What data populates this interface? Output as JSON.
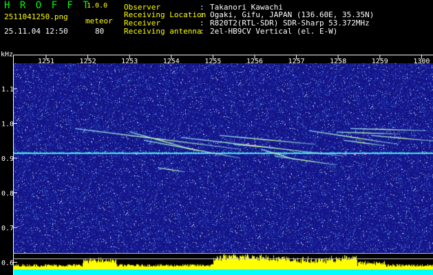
{
  "header": {
    "app_title": "H R O F F T",
    "app_version": "1.0.0",
    "filename": "2511041250.png",
    "meteor_label": "meteor",
    "timestamp": "25.11.04 12:50",
    "meteor_count": "80"
  },
  "info": [
    {
      "label": "Observer",
      "sep": ":",
      "value": "Takanori Kawachi"
    },
    {
      "label": "Receiving Location",
      "sep": ":",
      "value": "Ogaki, Gifu, JAPAN (136.60E, 35.35N)"
    },
    {
      "label": "Receiver",
      "sep": ":",
      "value": "R820T2(RTL-SDR) SDR-Sharp 53.372MHz"
    },
    {
      "label": "Receiving antenna",
      "sep": ":",
      "value": "2el-HB9CV Vertical (el. E-W)"
    }
  ],
  "axis": {
    "y_unit": "kHz",
    "x_ticks": [
      "1251",
      "1252",
      "1253",
      "1254",
      "1255",
      "1256",
      "1257",
      "1258",
      "1259",
      "1300"
    ],
    "y_ticks": [
      "1.1",
      "1.0",
      "0.9",
      "0.8",
      "0.7",
      "0.6"
    ]
  },
  "colors": {
    "title_green": "#00ff00",
    "label_yellow": "#ffff00",
    "background": "#000000",
    "spectrogram_base": "#1a1a8c",
    "carrier_line": "#40e0ff",
    "signal_bars": "#ffff00",
    "floor_bar": "#00ffff"
  }
}
